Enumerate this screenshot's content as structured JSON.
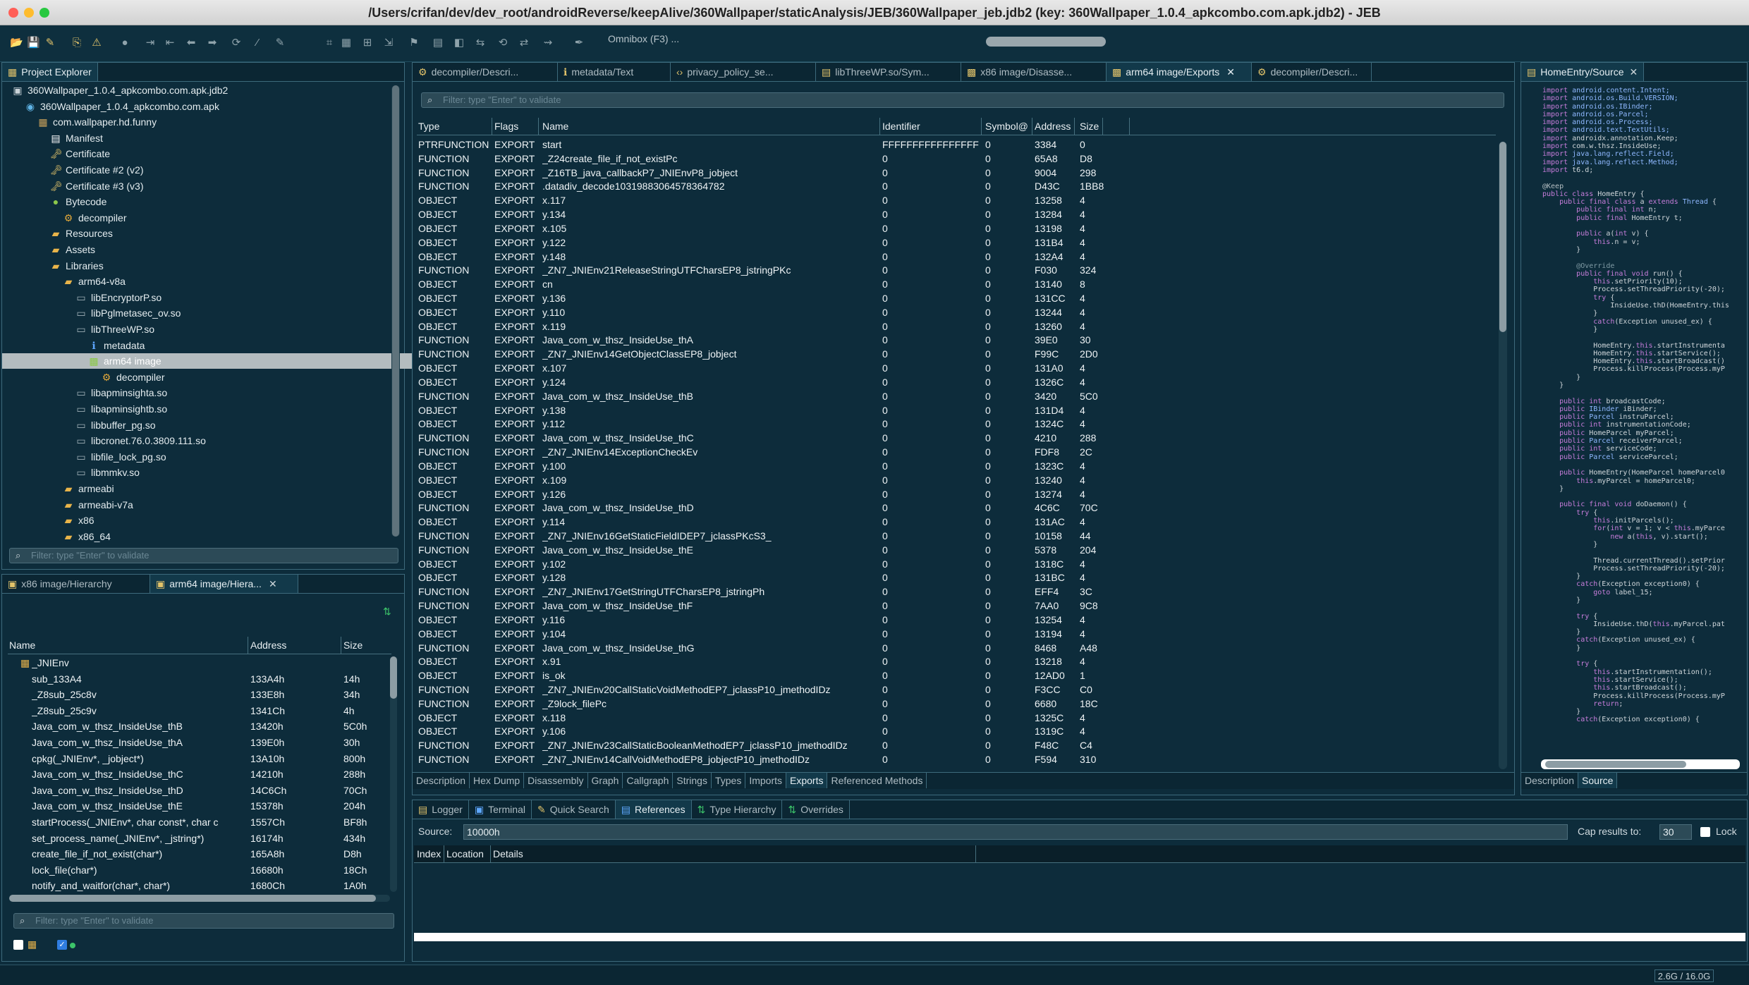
{
  "window": {
    "title": "/Users/crifan/dev/dev_root/androidReverse/keepAlive/360Wallpaper/staticAnalysis/JEB/360Wallpaper_jeb.jdb2 (key: 360Wallpaper_1.0.4_apkcombo.com.apk.jdb2) - JEB"
  },
  "toolbar": {
    "omnibox": "Omnibox (F3) ..."
  },
  "colors": {
    "background": "#0d2c3b",
    "border": "#3d6a7c",
    "selection": "#b4bcbf",
    "accent_gold": "#e2c36a"
  },
  "project_explorer": {
    "tab": "Project Explorer",
    "filter_placeholder": "Filter: type \"Enter\" to validate",
    "tree": [
      {
        "label": "360Wallpaper_1.0.4_apkcombo.com.apk.jdb2",
        "icon": "project-icon"
      },
      {
        "label": "360Wallpaper_1.0.4_apkcombo.com.apk",
        "icon": "apk-icon"
      },
      {
        "label": "com.wallpaper.hd.funny",
        "icon": "package-icon"
      },
      {
        "label": "Manifest",
        "icon": "manifest-icon"
      },
      {
        "label": "Certificate",
        "icon": "key-icon"
      },
      {
        "label": "Certificate #2 (v2)",
        "icon": "key-icon"
      },
      {
        "label": "Certificate #3 (v3)",
        "icon": "key-icon"
      },
      {
        "label": "Bytecode",
        "icon": "android-icon"
      },
      {
        "label": "decompiler",
        "icon": "gear-icon"
      },
      {
        "label": "Resources",
        "icon": "folder-icon"
      },
      {
        "label": "Assets",
        "icon": "folder-icon"
      },
      {
        "label": "Libraries",
        "icon": "folder-icon"
      },
      {
        "label": "arm64-v8a",
        "icon": "folder-icon"
      },
      {
        "label": "libEncryptorP.so",
        "icon": "file-icon"
      },
      {
        "label": "libPglmetasec_ov.so",
        "icon": "file-icon"
      },
      {
        "label": "libThreeWP.so",
        "icon": "file-icon"
      },
      {
        "label": "metadata",
        "icon": "info-icon"
      },
      {
        "label": "arm64 image",
        "icon": "chip-icon"
      },
      {
        "label": "decompiler",
        "icon": "gear-icon"
      },
      {
        "label": "libapminsighta.so",
        "icon": "file-icon"
      },
      {
        "label": "libapminsightb.so",
        "icon": "file-icon"
      },
      {
        "label": "libbuffer_pg.so",
        "icon": "file-icon"
      },
      {
        "label": "libcronet.76.0.3809.111.so",
        "icon": "file-icon"
      },
      {
        "label": "libfile_lock_pg.so",
        "icon": "file-icon"
      },
      {
        "label": "libmmkv.so",
        "icon": "file-icon"
      },
      {
        "label": "armeabi",
        "icon": "folder-icon"
      },
      {
        "label": "armeabi-v7a",
        "icon": "folder-icon"
      },
      {
        "label": "x86",
        "icon": "folder-icon"
      },
      {
        "label": "x86_64",
        "icon": "folder-icon"
      }
    ]
  },
  "hierarchy": {
    "tabs": [
      "x86 image/Hierarchy",
      "arm64 image/Hiera..."
    ],
    "columns": [
      "Name",
      "Address",
      "Size"
    ],
    "rows": [
      [
        "_JNIEnv",
        "",
        ""
      ],
      [
        "sub_133A4",
        "133A4h",
        "14h"
      ],
      [
        "_Z8sub_25c8v",
        "133E8h",
        "34h"
      ],
      [
        "_Z8sub_25c9v",
        "1341Ch",
        "4h"
      ],
      [
        "Java_com_w_thsz_InsideUse_thB",
        "13420h",
        "5C0h"
      ],
      [
        "Java_com_w_thsz_InsideUse_thA",
        "139E0h",
        "30h"
      ],
      [
        "cpkg(_JNIEnv*, _jobject*)",
        "13A10h",
        "800h"
      ],
      [
        "Java_com_w_thsz_InsideUse_thC",
        "14210h",
        "288h"
      ],
      [
        "Java_com_w_thsz_InsideUse_thD",
        "14C6Ch",
        "70Ch"
      ],
      [
        "Java_com_w_thsz_InsideUse_thE",
        "15378h",
        "204h"
      ],
      [
        "startProcess(_JNIEnv*, char const*, char c",
        "1557Ch",
        "BF8h"
      ],
      [
        "set_process_name(_JNIEnv*, _jstring*)",
        "16174h",
        "434h"
      ],
      [
        "create_file_if_not_exist(char*)",
        "165A8h",
        "D8h"
      ],
      [
        "lock_file(char*)",
        "16680h",
        "18Ch"
      ],
      [
        "notify_and_waitfor(char*, char*)",
        "1680Ch",
        "1A0h"
      ]
    ],
    "filter_placeholder": "Filter: type \"Enter\" to validate"
  },
  "editor": {
    "tabs": [
      "decompiler/Descri...",
      "metadata/Text",
      "privacy_policy_se...",
      "libThreeWP.so/Sym...",
      "x86 image/Disasse...",
      "arm64 image/Exports",
      "decompiler/Descri..."
    ],
    "filter_placeholder": "Filter: type \"Enter\" to validate",
    "columns": [
      "Type",
      "Flags",
      "Name",
      "Identifier",
      "Symbol@",
      "Address",
      "Size"
    ],
    "rows": [
      [
        "PTRFUNCTION",
        "EXPORT",
        "start",
        "FFFFFFFFFFFFFFFF",
        "0",
        "3384",
        "0"
      ],
      [
        "FUNCTION",
        "EXPORT",
        "_Z24create_file_if_not_existPc",
        "0",
        "0",
        "65A8",
        "D8"
      ],
      [
        "FUNCTION",
        "EXPORT",
        "_Z16TB_java_callbackP7_JNIEnvP8_jobject",
        "0",
        "0",
        "9004",
        "298"
      ],
      [
        "FUNCTION",
        "EXPORT",
        ".datadiv_decode10319883064578364782",
        "0",
        "0",
        "D43C",
        "1BB8"
      ],
      [
        "OBJECT",
        "EXPORT",
        "x.117",
        "0",
        "0",
        "13258",
        "4"
      ],
      [
        "OBJECT",
        "EXPORT",
        "y.134",
        "0",
        "0",
        "13284",
        "4"
      ],
      [
        "OBJECT",
        "EXPORT",
        "x.105",
        "0",
        "0",
        "13198",
        "4"
      ],
      [
        "OBJECT",
        "EXPORT",
        "y.122",
        "0",
        "0",
        "131B4",
        "4"
      ],
      [
        "OBJECT",
        "EXPORT",
        "y.148",
        "0",
        "0",
        "132A4",
        "4"
      ],
      [
        "FUNCTION",
        "EXPORT",
        "_ZN7_JNIEnv21ReleaseStringUTFCharsEP8_jstringPKc",
        "0",
        "0",
        "F030",
        "324"
      ],
      [
        "OBJECT",
        "EXPORT",
        "cn",
        "0",
        "0",
        "13140",
        "8"
      ],
      [
        "OBJECT",
        "EXPORT",
        "y.136",
        "0",
        "0",
        "131CC",
        "4"
      ],
      [
        "OBJECT",
        "EXPORT",
        "y.110",
        "0",
        "0",
        "13244",
        "4"
      ],
      [
        "OBJECT",
        "EXPORT",
        "x.119",
        "0",
        "0",
        "13260",
        "4"
      ],
      [
        "FUNCTION",
        "EXPORT",
        "Java_com_w_thsz_InsideUse_thA",
        "0",
        "0",
        "39E0",
        "30"
      ],
      [
        "FUNCTION",
        "EXPORT",
        "_ZN7_JNIEnv14GetObjectClassEP8_jobject",
        "0",
        "0",
        "F99C",
        "2D0"
      ],
      [
        "OBJECT",
        "EXPORT",
        "x.107",
        "0",
        "0",
        "131A0",
        "4"
      ],
      [
        "OBJECT",
        "EXPORT",
        "y.124",
        "0",
        "0",
        "1326C",
        "4"
      ],
      [
        "FUNCTION",
        "EXPORT",
        "Java_com_w_thsz_InsideUse_thB",
        "0",
        "0",
        "3420",
        "5C0"
      ],
      [
        "OBJECT",
        "EXPORT",
        "y.138",
        "0",
        "0",
        "131D4",
        "4"
      ],
      [
        "OBJECT",
        "EXPORT",
        "y.112",
        "0",
        "0",
        "1324C",
        "4"
      ],
      [
        "FUNCTION",
        "EXPORT",
        "Java_com_w_thsz_InsideUse_thC",
        "0",
        "0",
        "4210",
        "288"
      ],
      [
        "FUNCTION",
        "EXPORT",
        "_ZN7_JNIEnv14ExceptionCheckEv",
        "0",
        "0",
        "FDF8",
        "2C"
      ],
      [
        "OBJECT",
        "EXPORT",
        "y.100",
        "0",
        "0",
        "1323C",
        "4"
      ],
      [
        "OBJECT",
        "EXPORT",
        "x.109",
        "0",
        "0",
        "13240",
        "4"
      ],
      [
        "OBJECT",
        "EXPORT",
        "y.126",
        "0",
        "0",
        "13274",
        "4"
      ],
      [
        "FUNCTION",
        "EXPORT",
        "Java_com_w_thsz_InsideUse_thD",
        "0",
        "0",
        "4C6C",
        "70C"
      ],
      [
        "OBJECT",
        "EXPORT",
        "y.114",
        "0",
        "0",
        "131AC",
        "4"
      ],
      [
        "FUNCTION",
        "EXPORT",
        "_ZN7_JNIEnv16GetStaticFieldIDEP7_jclassPKcS3_",
        "0",
        "0",
        "10158",
        "44"
      ],
      [
        "FUNCTION",
        "EXPORT",
        "Java_com_w_thsz_InsideUse_thE",
        "0",
        "0",
        "5378",
        "204"
      ],
      [
        "OBJECT",
        "EXPORT",
        "y.102",
        "0",
        "0",
        "1318C",
        "4"
      ],
      [
        "OBJECT",
        "EXPORT",
        "y.128",
        "0",
        "0",
        "131BC",
        "4"
      ],
      [
        "FUNCTION",
        "EXPORT",
        "_ZN7_JNIEnv17GetStringUTFCharsEP8_jstringPh",
        "0",
        "0",
        "EFF4",
        "3C"
      ],
      [
        "FUNCTION",
        "EXPORT",
        "Java_com_w_thsz_InsideUse_thF",
        "0",
        "0",
        "7AA0",
        "9C8"
      ],
      [
        "OBJECT",
        "EXPORT",
        "y.116",
        "0",
        "0",
        "13254",
        "4"
      ],
      [
        "OBJECT",
        "EXPORT",
        "y.104",
        "0",
        "0",
        "13194",
        "4"
      ],
      [
        "FUNCTION",
        "EXPORT",
        "Java_com_w_thsz_InsideUse_thG",
        "0",
        "0",
        "8468",
        "A48"
      ],
      [
        "OBJECT",
        "EXPORT",
        "x.91",
        "0",
        "0",
        "13218",
        "4"
      ],
      [
        "OBJECT",
        "EXPORT",
        "is_ok",
        "0",
        "0",
        "12AD0",
        "1"
      ],
      [
        "FUNCTION",
        "EXPORT",
        "_ZN7_JNIEnv20CallStaticVoidMethodEP7_jclassP10_jmethodIDz",
        "0",
        "0",
        "F3CC",
        "C0"
      ],
      [
        "FUNCTION",
        "EXPORT",
        "_Z9lock_filePc",
        "0",
        "0",
        "6680",
        "18C"
      ],
      [
        "OBJECT",
        "EXPORT",
        "x.118",
        "0",
        "0",
        "1325C",
        "4"
      ],
      [
        "OBJECT",
        "EXPORT",
        "y.106",
        "0",
        "0",
        "1319C",
        "4"
      ],
      [
        "FUNCTION",
        "EXPORT",
        "_ZN7_JNIEnv23CallStaticBooleanMethodEP7_jclassP10_jmethodIDz",
        "0",
        "0",
        "F48C",
        "C4"
      ],
      [
        "FUNCTION",
        "EXPORT",
        "_ZN7_JNIEnv14CallVoidMethodEP8_jobjectP10_jmethodIDz",
        "0",
        "0",
        "F594",
        "310"
      ]
    ],
    "subtabs": [
      "Description",
      "Hex Dump",
      "Disassembly",
      "Graph",
      "Callgraph",
      "Strings",
      "Types",
      "Imports",
      "Exports",
      "Referenced Methods"
    ]
  },
  "bottom": {
    "tabs": [
      "Logger",
      "Terminal",
      "Quick Search",
      "References",
      "Type Hierarchy",
      "Overrides"
    ],
    "source_label": "Source:",
    "source_value": "10000h",
    "cap_label": "Cap results to:",
    "cap_value": "30",
    "lock_label": "Lock",
    "columns": [
      "Index",
      "Location",
      "Details"
    ]
  },
  "source_panel": {
    "tab": "HomeEntry/Source",
    "subtabs": [
      "Description",
      "Source"
    ]
  },
  "status": {
    "memory": "2.6G / 16.0G"
  }
}
